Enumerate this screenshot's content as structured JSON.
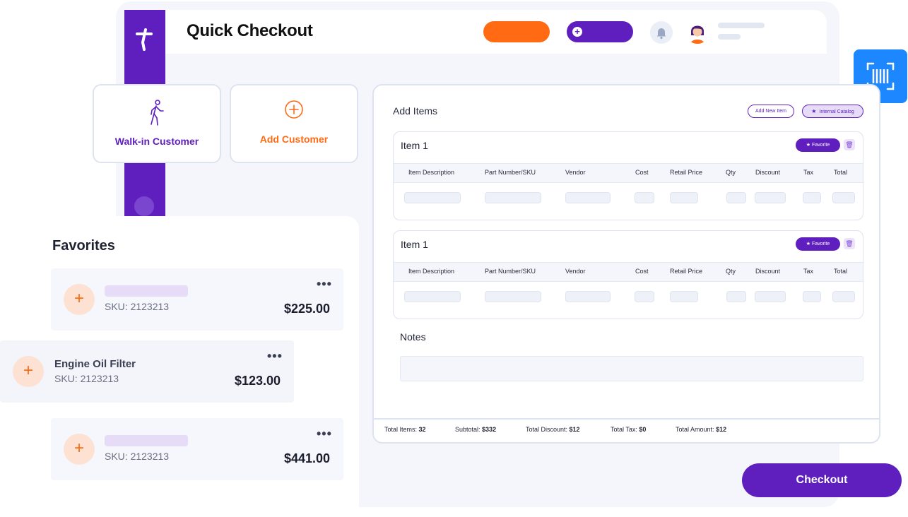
{
  "header": {
    "title": "Quick Checkout"
  },
  "customer_options": {
    "walkin_label": "Walk-in Customer",
    "add_label": "Add Customer"
  },
  "favorites": {
    "title": "Favorites",
    "items": [
      {
        "name": "",
        "sku": "SKU: 2123213",
        "price": "$225.00"
      },
      {
        "name": "Engine Oil Filter",
        "sku": "SKU: 2123213",
        "price": "$123.00"
      },
      {
        "name": "",
        "sku": "SKU: 2123213",
        "price": "$441.00"
      }
    ]
  },
  "add_items": {
    "title": "Add Items",
    "add_new_label": "Add New Item",
    "catalog_label": "Internal Catalog",
    "favorite_label": "Favorite",
    "columns": [
      "Item Description",
      "Part Number/SKU",
      "Vendor",
      "Cost",
      "Retail Price",
      "Qty",
      "Discount",
      "Tax",
      "Total"
    ],
    "items": [
      {
        "title": "Item 1"
      },
      {
        "title": "Item 1"
      }
    ],
    "notes_label": "Notes"
  },
  "totals": {
    "items_label": "Total Items:",
    "items_value": "32",
    "subtotal_label": "Subtotal:",
    "subtotal_value": "$332",
    "discount_label": "Total Discount:",
    "discount_value": "$12",
    "tax_label": "Total Tax:",
    "tax_value": "$0",
    "amount_label": "Total Amount:",
    "amount_value": "$12"
  },
  "checkout_label": "Checkout",
  "colors": {
    "brand_purple": "#5f1fbf",
    "accent_orange": "#ff6a13",
    "scan_blue": "#1d87ff"
  },
  "icons": {
    "logo": "brand-logo-icon",
    "bell": "bell-icon",
    "walkin": "walking-person-icon",
    "add": "plus-circle-icon",
    "scan": "barcode-scan-icon",
    "star": "star-icon",
    "trash": "trash-icon",
    "more": "more-dots-icon"
  }
}
